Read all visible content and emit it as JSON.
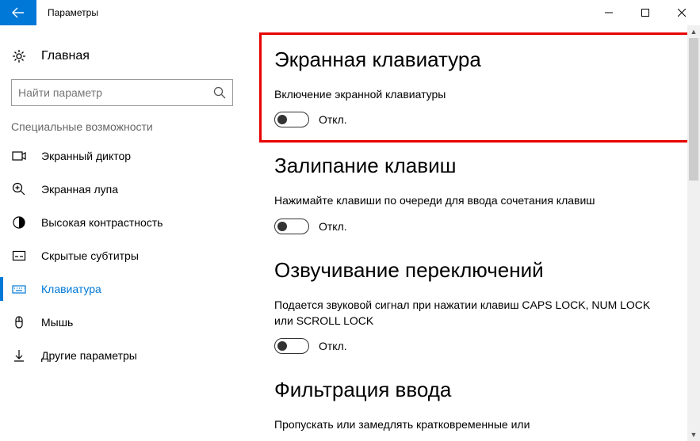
{
  "window": {
    "title": "Параметры"
  },
  "sidebar": {
    "home_label": "Главная",
    "search_placeholder": "Найти параметр",
    "group_label": "Специальные возможности",
    "items": [
      {
        "label": "Экранный диктор"
      },
      {
        "label": "Экранная лупа"
      },
      {
        "label": "Высокая контрастность"
      },
      {
        "label": "Скрытые субтитры"
      },
      {
        "label": "Клавиатура"
      },
      {
        "label": "Мышь"
      },
      {
        "label": "Другие параметры"
      }
    ]
  },
  "content": {
    "s1": {
      "heading": "Экранная клавиатура",
      "desc": "Включение экранной клавиатуры",
      "toggle": "Откл."
    },
    "s2": {
      "heading": "Залипание клавиш",
      "desc": "Нажимайте клавиши по очереди для ввода сочетания клавиш",
      "toggle": "Откл."
    },
    "s3": {
      "heading": "Озвучивание переключений",
      "desc": "Подается звуковой сигнал при нажатии клавиш CAPS LOCK, NUM LOCK или SCROLL LOCK",
      "toggle": "Откл."
    },
    "s4": {
      "heading": "Фильтрация ввода",
      "desc": "Пропускать или замедлять кратковременные или"
    }
  }
}
